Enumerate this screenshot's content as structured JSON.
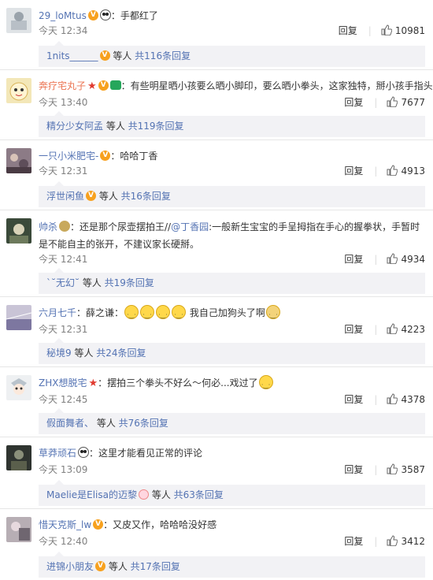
{
  "comments": [
    {
      "user": "29_loMtus",
      "text": "：手都红了",
      "time": "今天 12:34",
      "reply_label": "回复",
      "likes": "10981",
      "replies_user": "1nits______",
      "replies_mid": " 等人 ",
      "replies_count": "共116条回复"
    },
    {
      "user": "奔疗宅丸子",
      "text": "：有些明星晒小孩要么晒小脚印，要么晒小拳头，这家独特，掰小孩手指头。",
      "time": "今天 13:40",
      "reply_label": "回复",
      "likes": "7677",
      "replies_user": "精分少女阿孟",
      "replies_mid": " 等人 ",
      "replies_count": "共119条回复"
    },
    {
      "user": "一只小米肥宅-",
      "text": "：哈哈丁香",
      "time": "今天 12:31",
      "reply_label": "回复",
      "likes": "4913",
      "replies_user": "浮世闲鱼",
      "replies_mid": " 等人 ",
      "replies_count": "共16条回复"
    },
    {
      "user": "帅杀",
      "text_a": "：还是那个尿壶摆拍王//",
      "mention": "@丁香园",
      "text_b": ":一般新生宝宝的手呈拇指在手心的握拳状，手暂时是不能自主的张开，不建议家长硬掰。",
      "time": "今天 12:41",
      "reply_label": "回复",
      "likes": "4934",
      "replies_user": "`˘无幻˘",
      "replies_mid": " 等人 ",
      "replies_count": "共19条回复"
    },
    {
      "user": "六月七千",
      "text_a": "：薛之谦：",
      "text_b": " 我自己加狗头了啊",
      "time": "今天 12:31",
      "reply_label": "回复",
      "likes": "4223",
      "replies_user": "秘境9",
      "replies_mid": " 等人 ",
      "replies_count": "共24条回复"
    },
    {
      "user": "ZHX想脱宅",
      "text": "：摆拍三个拳头不好么～何必...戏过了",
      "time": "今天 12:45",
      "reply_label": "回复",
      "likes": "4378",
      "replies_user": "假面舞者、",
      "replies_mid": " 等人 ",
      "replies_count": "共76条回复"
    },
    {
      "user": "草莽顽石",
      "text": "：这里才能看见正常的评论",
      "time": "今天 13:09",
      "reply_label": "回复",
      "likes": "3587",
      "replies_user": "Maelie是Elisa的迈黎",
      "replies_mid": " 等人 ",
      "replies_count": "共63条回复"
    },
    {
      "user": "惜天克斯_lw",
      "text": "：又皮又作，哈哈哈没好感",
      "time": "今天 12:40",
      "reply_label": "回复",
      "likes": "3412",
      "replies_user": "进锦小朋友",
      "replies_mid": " 等人 ",
      "replies_count": "共17条回复"
    }
  ],
  "colors": {
    "username": "#eb7350",
    "link": "#5473b3",
    "reply_bg": "#f2f2f5",
    "time": "#808080"
  },
  "icons": [
    "vip-badge-icon",
    "panda-icon",
    "thumbs-up-icon",
    "smile-emoji-icon"
  ]
}
